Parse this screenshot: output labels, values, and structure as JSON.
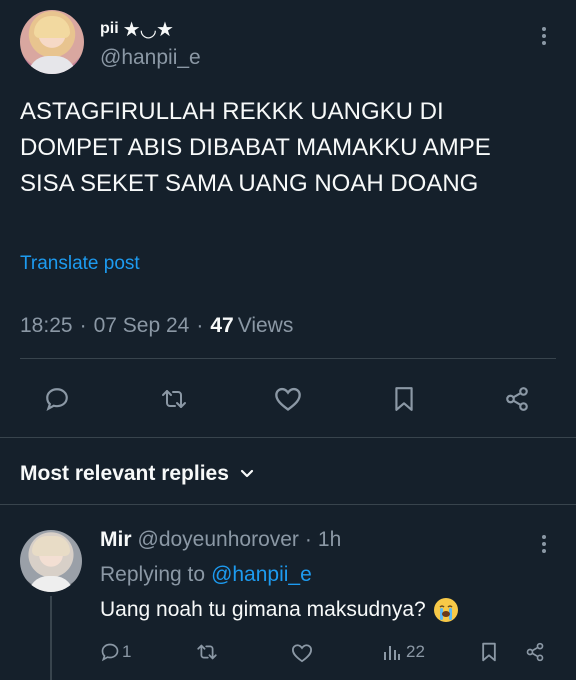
{
  "tweet": {
    "author_name": "pii",
    "author_name_symbols": "★◡★",
    "author_handle": "@hanpii_e",
    "text": "ASTAGFIRULLAH REKKK UANGKU DI DOMPET ABIS DIBABAT MAMAKKU AMPE SISA SEKET SAMA UANG NOAH DOANG",
    "translate_label": "Translate post",
    "time": "18:25",
    "date": "07 Sep 24",
    "views_count": "47",
    "views_label": "Views",
    "sep": "·"
  },
  "replies_header": {
    "label": "Most relevant replies"
  },
  "reply": {
    "author_name": "Mir",
    "author_handle": "@doyeunhorover",
    "time_ago": "1h",
    "replying_to_label": "Replying to",
    "replying_to_handle": "@hanpii_e",
    "text": "Uang noah tu gimana maksudnya?",
    "reply_count": "1",
    "views_count": "22",
    "sep": "·"
  },
  "icons": {
    "reply": "speech-bubble-icon",
    "retweet": "retweet-icon",
    "like": "heart-icon",
    "bookmark": "bookmark-icon",
    "share": "share-icon",
    "views": "bar-chart-icon",
    "more": "vertical-dots-icon",
    "chevron": "chevron-down-icon",
    "emoji": "loudly-crying-face-emoji"
  },
  "colors": {
    "background": "#15202b",
    "text": "#f7f9f9",
    "muted": "#8b98a5",
    "accent": "#1d9bf0",
    "divider": "#38444d"
  }
}
